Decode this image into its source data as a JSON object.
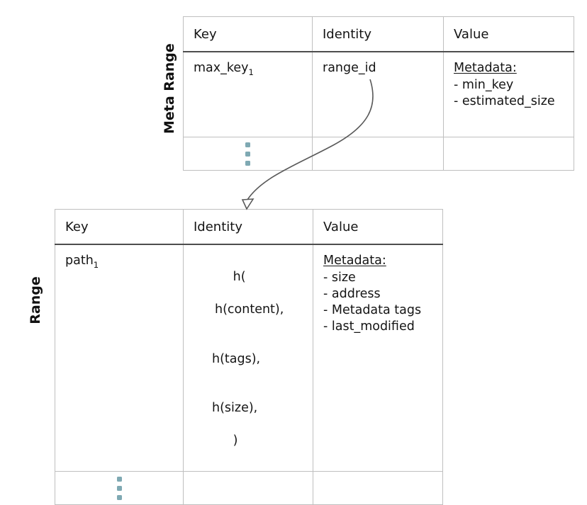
{
  "diagram": {
    "title": "Meta Range and Range table structure",
    "colors": {
      "grid_line": "#bfbfbf",
      "header_rule": "#4d4d4d",
      "dot": "#7fa9b3",
      "arrow": "#595959",
      "text": "#141414"
    }
  },
  "meta_range": {
    "side_label": "Meta Range",
    "headers": [
      "Key",
      "Identity",
      "Value"
    ],
    "row": {
      "key": "max_key",
      "key_subscript": "1",
      "identity": "range_id",
      "value_title": "Metadata:",
      "value_items": [
        "- min_key",
        "- estimated_size"
      ]
    },
    "ellipsis": "vertical-ellipsis"
  },
  "range": {
    "side_label": "Range",
    "headers": [
      "Key",
      "Identity",
      "Value"
    ],
    "row": {
      "key": "path",
      "key_subscript": "1",
      "identity_open": "h(",
      "identity_inner": [
        "h(content),",
        "h(tags),",
        "h(size),"
      ],
      "identity_close": ")",
      "value_title": "Metadata:",
      "value_items": [
        "- size",
        "- address",
        "- Metadata tags",
        "- last_modified"
      ]
    },
    "ellipsis": "vertical-ellipsis"
  },
  "connector": {
    "name": "range-id-to-range-arrow",
    "from": "meta_range.row.identity",
    "to": "range.table",
    "arrowhead": "open-triangle"
  }
}
